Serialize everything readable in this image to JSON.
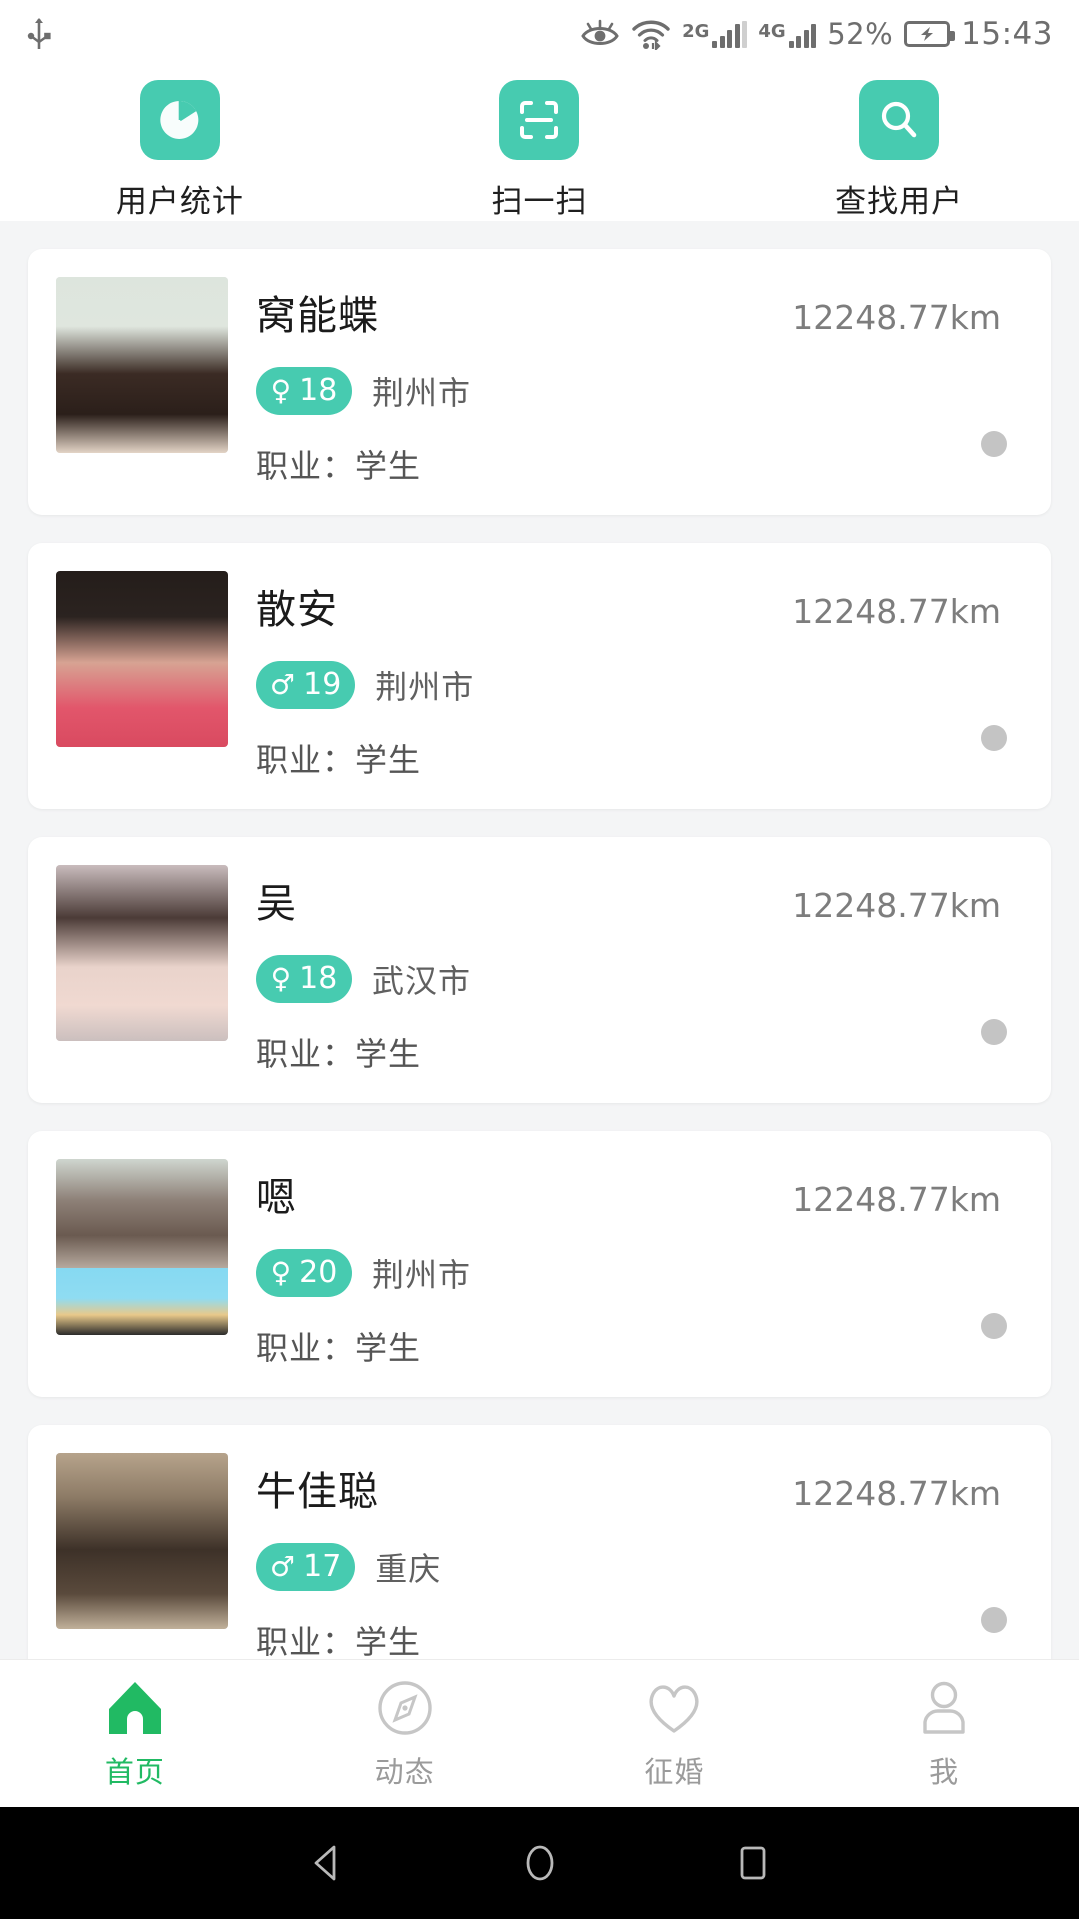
{
  "status_bar": {
    "usb_icon": "usb-icon",
    "eye_icon": "eye-care-icon",
    "wifi_icon": "wifi-icon",
    "sim1_label": "2G",
    "sim2_label": "4G",
    "battery_percent": "52%",
    "battery_icon": "battery-charging-icon",
    "clock": "15:43"
  },
  "quick_actions": [
    {
      "icon": "pie-chart-icon",
      "label": "用户统计"
    },
    {
      "icon": "scan-icon",
      "label": "扫一扫"
    },
    {
      "icon": "search-icon",
      "label": "查找用户"
    }
  ],
  "accent_color": "#47cbb0",
  "active_tab_color": "#21ba63",
  "occupation_prefix": "职业：",
  "users": [
    {
      "name": "窝能蝶",
      "distance": "12248.77km",
      "gender": "female",
      "gender_symbol": "♀",
      "age": "18",
      "city": "荆州市",
      "occupation": "职业：学生",
      "avatar_colors": [
        "#d8e2d7",
        "#3a2b25",
        "#e8d9cc"
      ]
    },
    {
      "name": "散安",
      "distance": "12248.77km",
      "gender": "male",
      "gender_symbol": "♂",
      "age": "19",
      "city": "荆州市",
      "occupation": "职业：学生",
      "avatar_colors": [
        "#2b2320",
        "#d9a090",
        "#e24a63"
      ]
    },
    {
      "name": "吴",
      "distance": "12248.77km",
      "gender": "female",
      "gender_symbol": "♀",
      "age": "18",
      "city": "武汉市",
      "occupation": "职业：学生",
      "avatar_colors": [
        "#cdbfc0",
        "#4a3a36",
        "#f0d7cf"
      ]
    },
    {
      "name": "嗯",
      "distance": "12248.77km",
      "gender": "female",
      "gender_symbol": "♀",
      "age": "20",
      "city": "荆州市",
      "occupation": "职业：学生",
      "avatar_colors": [
        "#cfd6cf",
        "#6a5a50",
        "#7fd4ef"
      ]
    },
    {
      "name": "牛佳聪",
      "distance": "12248.77km",
      "gender": "male",
      "gender_symbol": "♂",
      "age": "17",
      "city": "重庆",
      "occupation": "职业：学生",
      "avatar_colors": [
        "#b9a48c",
        "#3b2f27",
        "#c8b9a4"
      ]
    }
  ],
  "tab_bar": [
    {
      "icon": "home-icon",
      "label": "首页",
      "active": true
    },
    {
      "icon": "compass-icon",
      "label": "动态",
      "active": false
    },
    {
      "icon": "heart-icon",
      "label": "征婚",
      "active": false
    },
    {
      "icon": "person-icon",
      "label": "我",
      "active": false
    }
  ],
  "android_nav": [
    {
      "icon": "back-triangle-icon"
    },
    {
      "icon": "home-circle-icon"
    },
    {
      "icon": "recents-square-icon"
    }
  ]
}
